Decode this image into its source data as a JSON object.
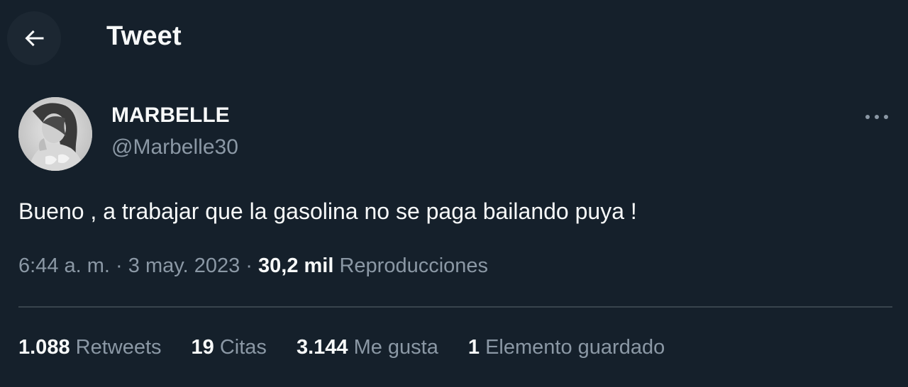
{
  "header": {
    "title": "Tweet",
    "back_icon": "arrow-left-icon"
  },
  "author": {
    "display_name": "MARBELLE",
    "handle": "@Marbelle30",
    "more_icon": "more-horizontal-icon"
  },
  "tweet": {
    "text": "Bueno , a trabajar que la gasolina no se paga bailando puya !",
    "time": "6:44 a. m.",
    "separator": "·",
    "date": "3 may. 2023",
    "views_count": "30,2 mil",
    "views_label": "Reproducciones"
  },
  "stats": {
    "retweets": {
      "count": "1.088",
      "label": "Retweets"
    },
    "quotes": {
      "count": "19",
      "label": "Citas"
    },
    "likes": {
      "count": "3.144",
      "label": "Me gusta"
    },
    "bookmarks": {
      "count": "1",
      "label": "Elemento guardado"
    }
  },
  "colors": {
    "background": "#15202b",
    "primary_text": "#f7f9f9",
    "secondary_text": "#8b98a5",
    "divider": "#38444d"
  }
}
